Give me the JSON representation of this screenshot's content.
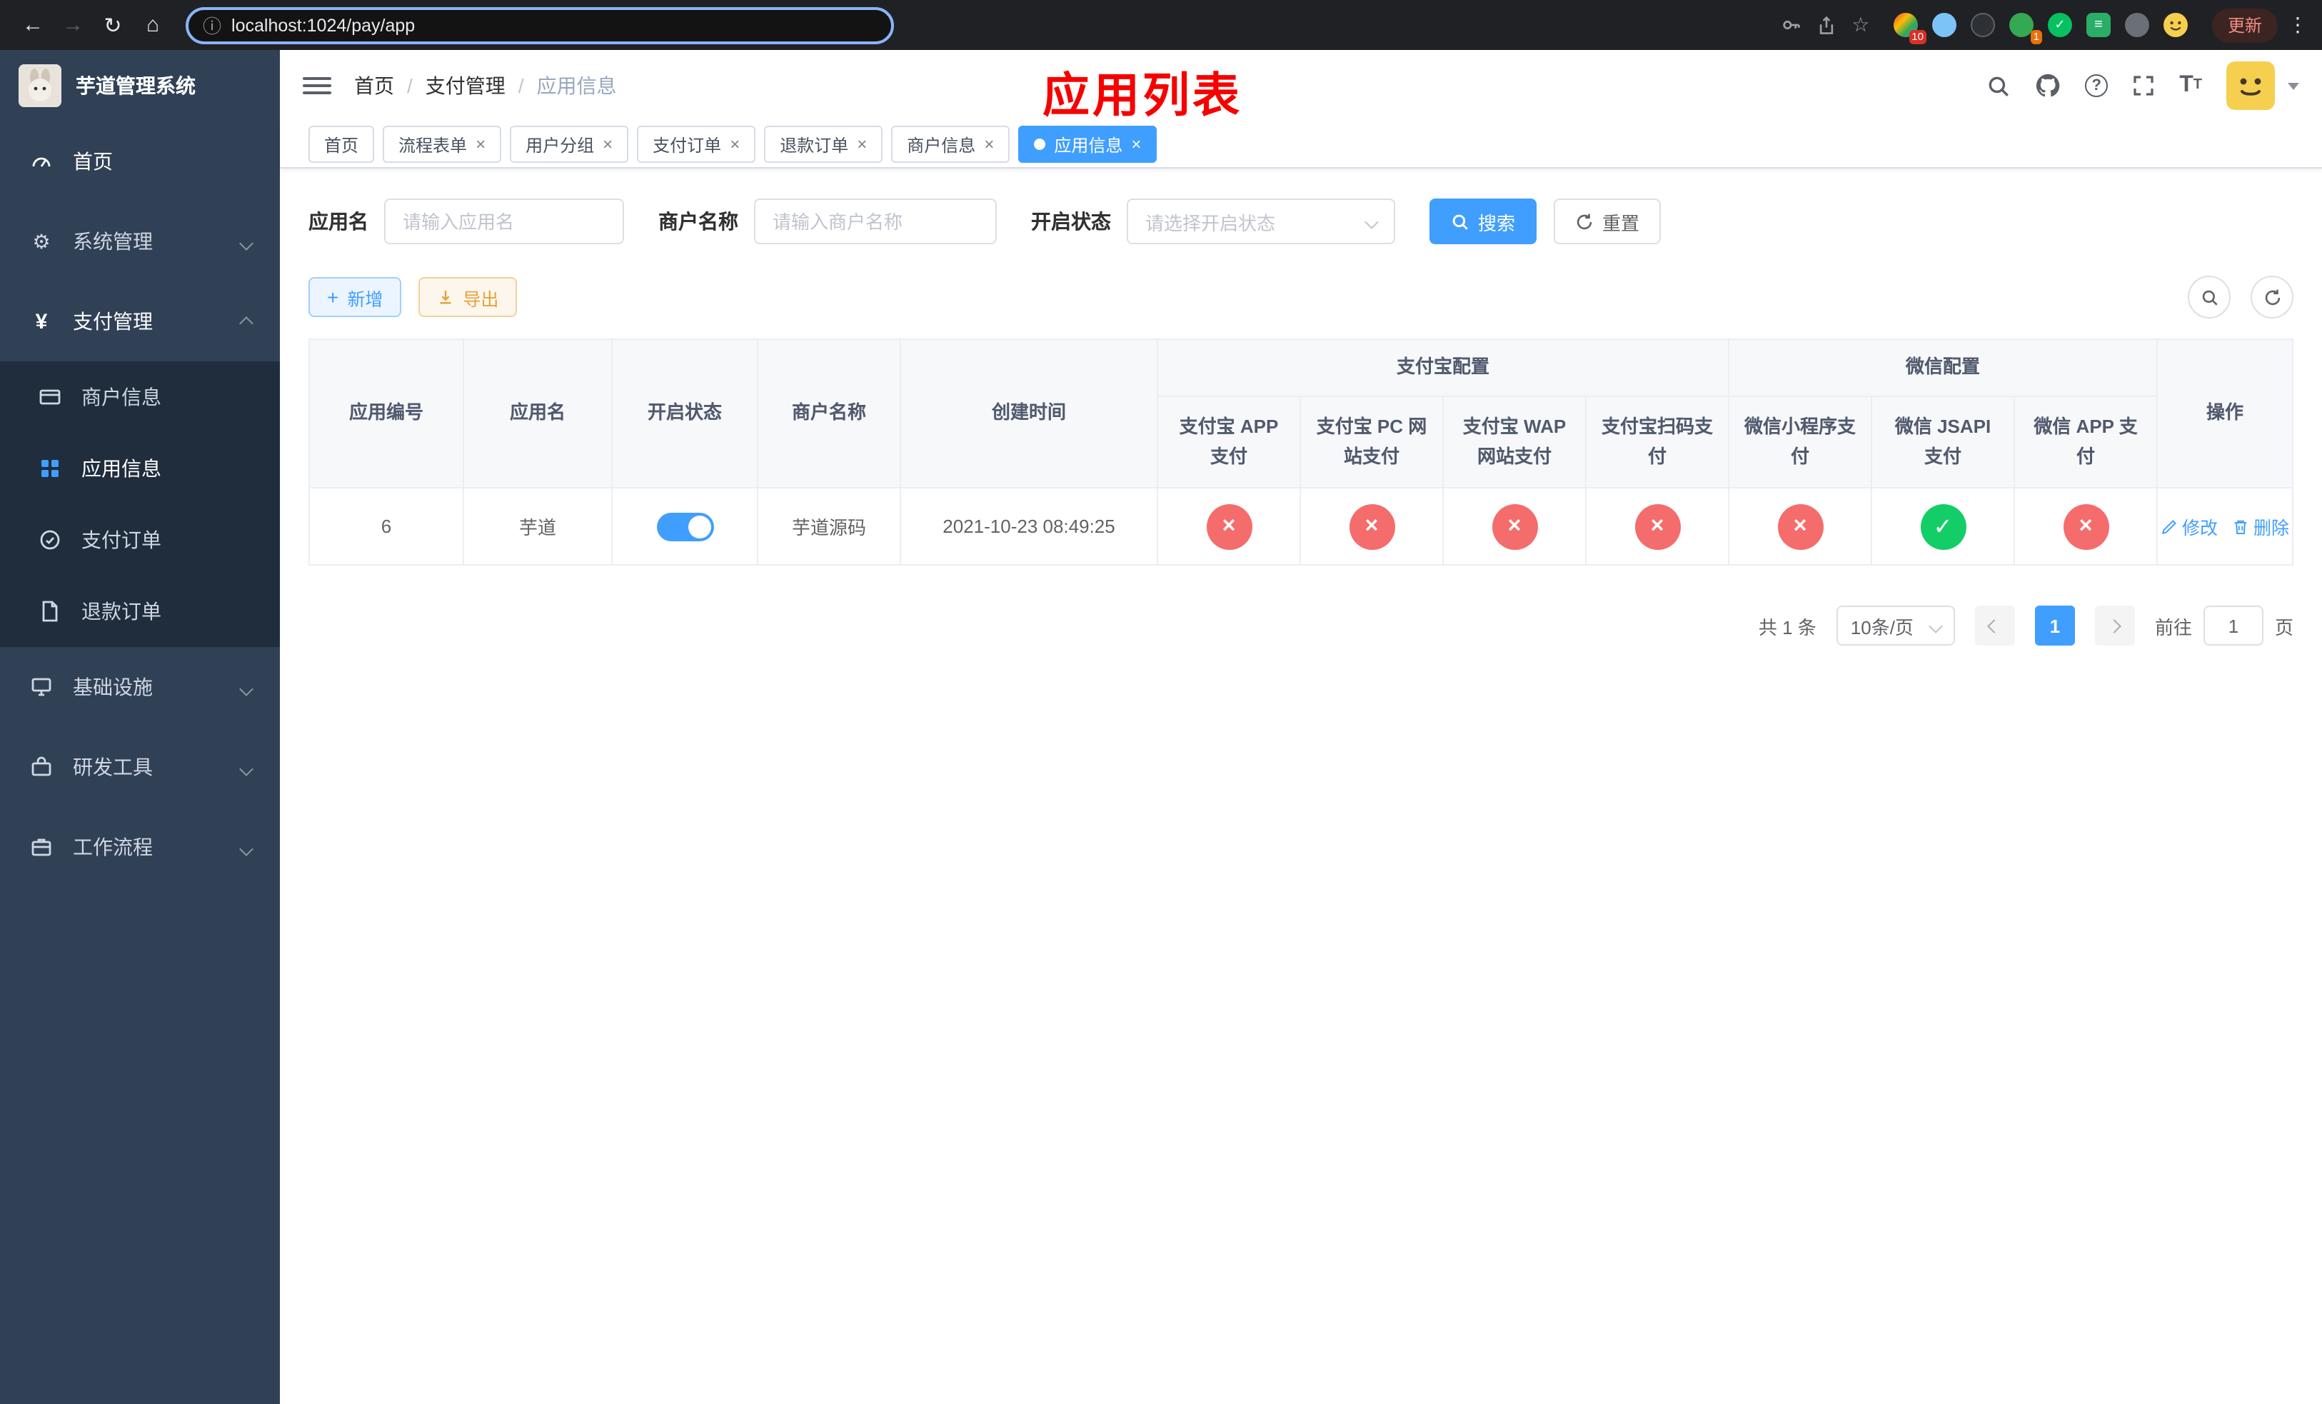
{
  "browser": {
    "url": "localhost:1024/pay/app",
    "update_label": "更新",
    "ext_badge_grid": "10",
    "ext_badge_green": "1"
  },
  "sidebar": {
    "title": "芋道管理系统",
    "menu": [
      {
        "label": "首页"
      },
      {
        "label": "系统管理"
      },
      {
        "label": "支付管理"
      },
      {
        "label": "基础设施"
      },
      {
        "label": "研发工具"
      },
      {
        "label": "工作流程"
      }
    ],
    "submenu": [
      {
        "label": "商户信息"
      },
      {
        "label": "应用信息"
      },
      {
        "label": "支付订单"
      },
      {
        "label": "退款订单"
      }
    ]
  },
  "header": {
    "breadcrumb": {
      "home": "首页",
      "sep": "/",
      "section": "支付管理",
      "current": "应用信息"
    },
    "annotation": "应用列表"
  },
  "tabs": [
    {
      "label": "首页"
    },
    {
      "label": "流程表单"
    },
    {
      "label": "用户分组"
    },
    {
      "label": "支付订单"
    },
    {
      "label": "退款订单"
    },
    {
      "label": "商户信息"
    },
    {
      "label": "应用信息"
    }
  ],
  "filters": {
    "app_name_label": "应用名",
    "app_name_placeholder": "请输入应用名",
    "merchant_label": "商户名称",
    "merchant_placeholder": "请输入商户名称",
    "status_label": "开启状态",
    "status_placeholder": "请选择开启状态",
    "search_label": "搜索",
    "reset_label": "重置"
  },
  "toolbar": {
    "add_label": "新增",
    "export_label": "导出"
  },
  "table": {
    "headers": {
      "app_id": "应用编号",
      "app_name": "应用名",
      "status": "开启状态",
      "merchant": "商户名称",
      "created": "创建时间",
      "alipay_group": "支付宝配置",
      "wechat_group": "微信配置",
      "actions": "操作",
      "alipay_cols": [
        "支付宝 APP 支付",
        "支付宝 PC 网站支付",
        "支付宝 WAP 网站支付",
        "支付宝扫码支付"
      ],
      "wechat_cols": [
        "微信小程序支付",
        "微信 JSAPI 支付",
        "微信 APP 支付"
      ]
    },
    "row": {
      "app_id": "6",
      "app_name": "芋道",
      "enabled": true,
      "merchant": "芋道源码",
      "created": "2021-10-23 08:49:25",
      "statuses": [
        "×",
        "×",
        "×",
        "×",
        "×",
        "✓",
        "×"
      ],
      "edit_label": "修改",
      "delete_label": "删除"
    }
  },
  "pagination": {
    "total": "共 1 条",
    "page_size": "10条/页",
    "page": "1",
    "goto_label": "前往",
    "goto_value": "1",
    "page_unit": "页"
  }
}
